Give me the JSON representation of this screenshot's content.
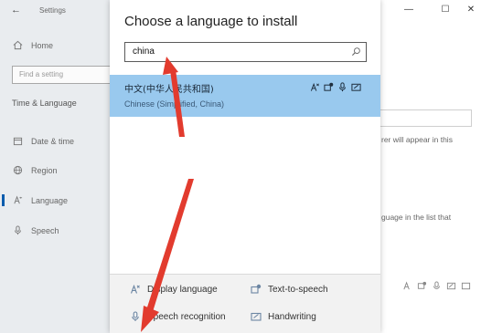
{
  "settings": {
    "app_title": "Settings",
    "home_label": "Home",
    "search_placeholder": "Find a setting",
    "section_title": "Time & Language",
    "nav": [
      {
        "label": "Date & time",
        "icon": "calendar-icon"
      },
      {
        "label": "Region",
        "icon": "globe-icon"
      },
      {
        "label": "Language",
        "icon": "language-icon"
      },
      {
        "label": "Speech",
        "icon": "microphone-icon"
      }
    ],
    "active_nav": "Language",
    "window_controls": {
      "minimize": "—",
      "maximize": "☐",
      "close": "✕"
    },
    "background_text": {
      "note_1": "rer will appear in this",
      "note_2": "guage in the list that"
    }
  },
  "dialog": {
    "title": "Choose a language to install",
    "search": {
      "value": "china",
      "icon": "search-icon"
    },
    "results": [
      {
        "native_name": "中文(中华人民共和国)",
        "english_name": "Chinese (Simplified, China)",
        "selected": true,
        "features": [
          "display-language-icon",
          "text-to-speech-icon",
          "speech-recognition-icon",
          "handwriting-icon"
        ]
      }
    ],
    "legend": {
      "display_language": "Display language",
      "text_to_speech": "Text-to-speech",
      "speech_recognition": "Speech recognition",
      "handwriting": "Handwriting"
    }
  },
  "colors": {
    "selection": "#99c9ee",
    "accent": "#0b5cad",
    "annotation_arrow": "#e23b2e"
  }
}
